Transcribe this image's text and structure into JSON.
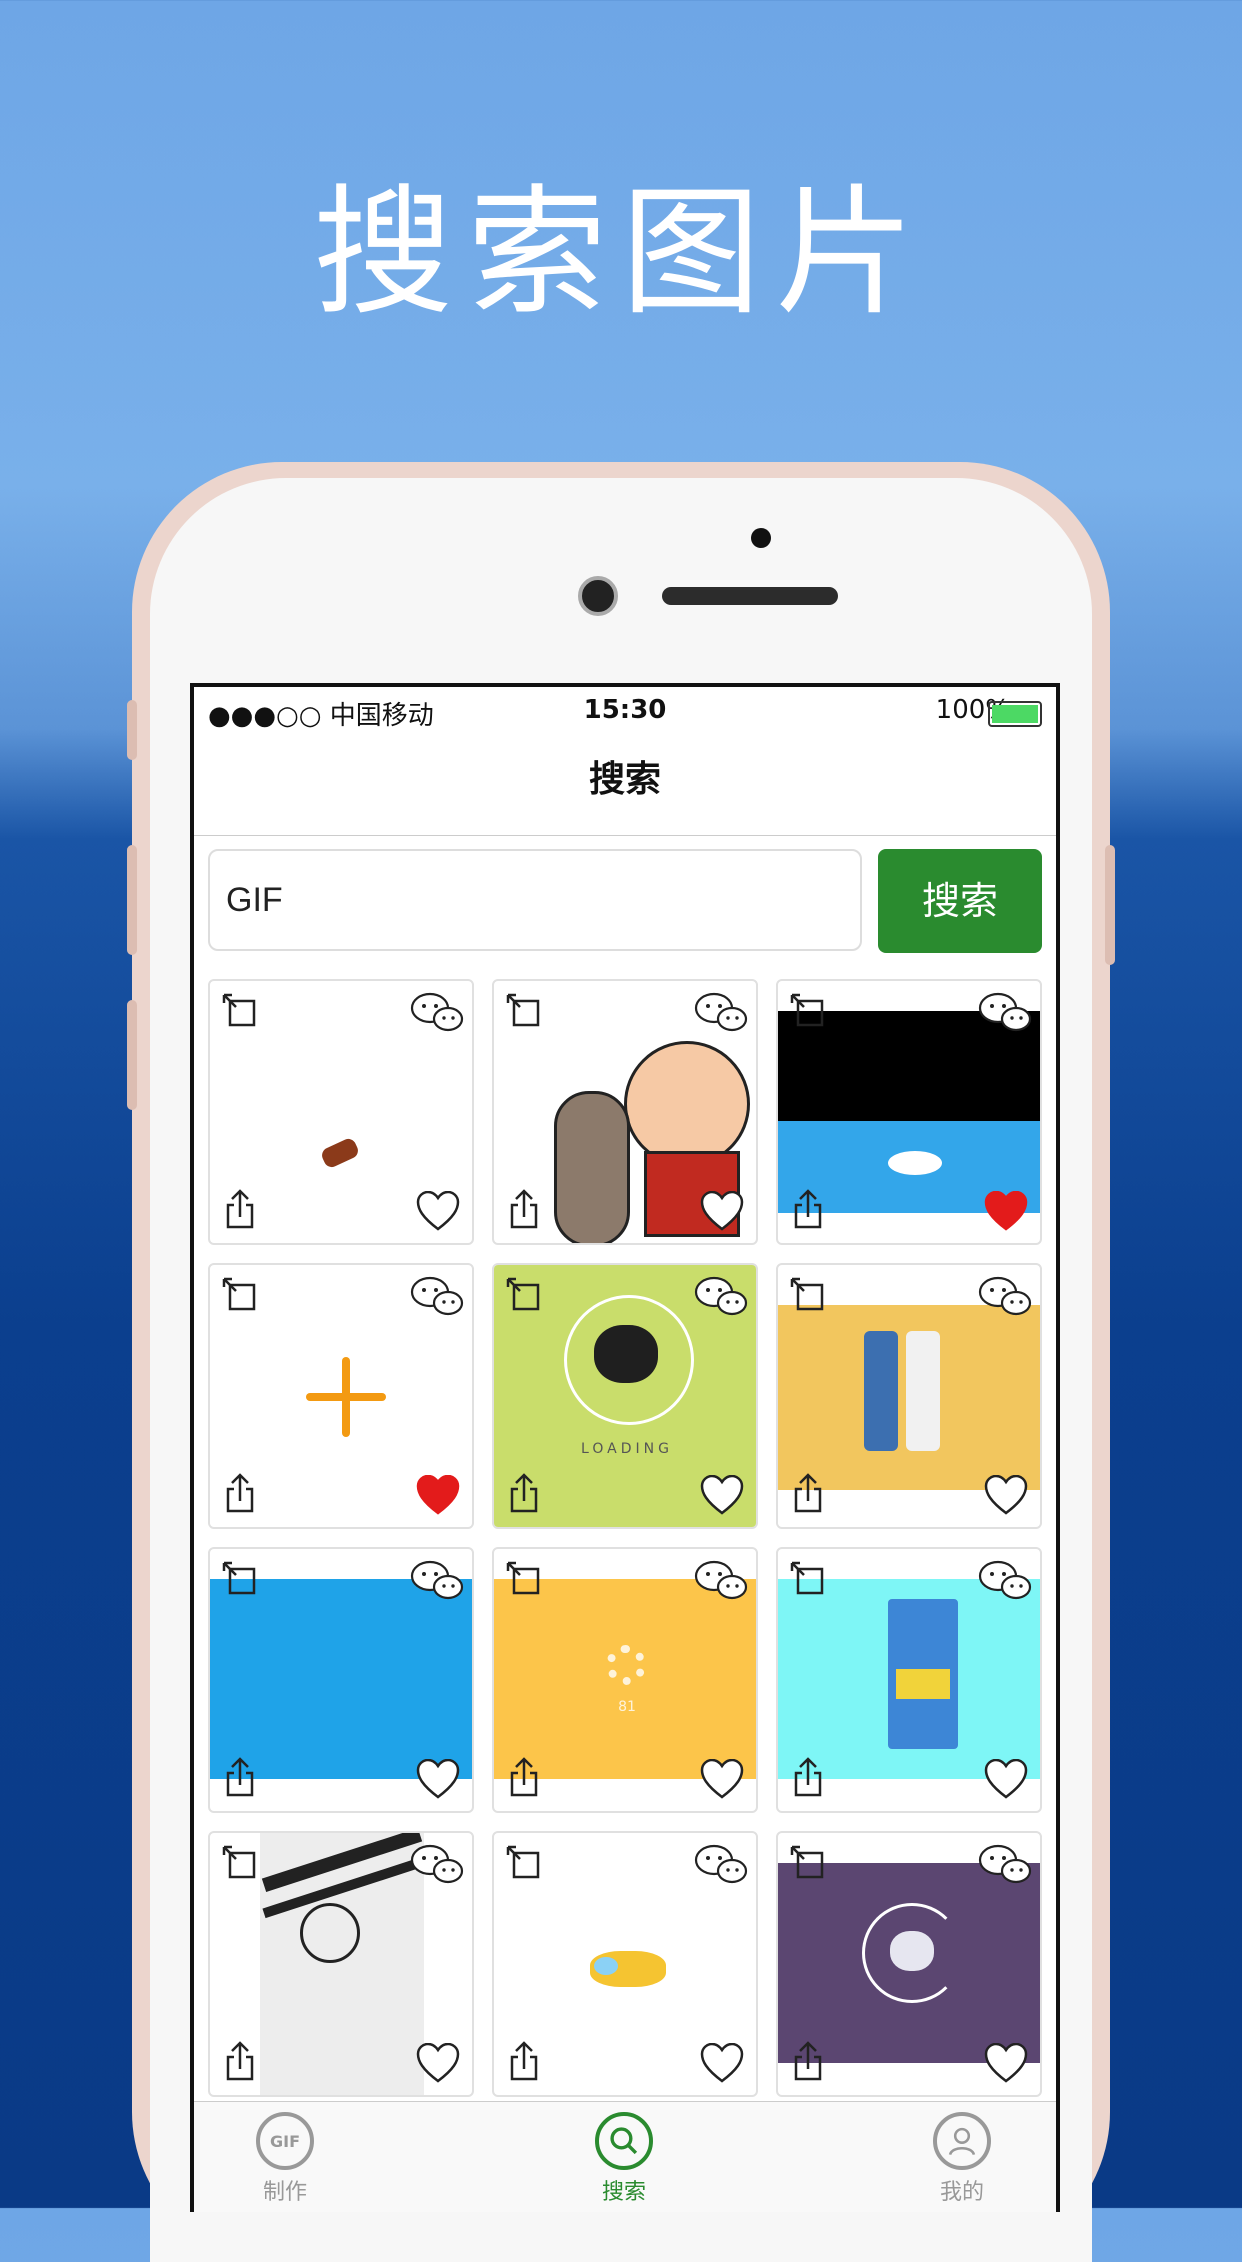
{
  "headline": "搜索图片",
  "status_bar": {
    "carrier": "●●●○○ 中国移动",
    "time": "15:30",
    "battery": "100%"
  },
  "nav": {
    "title": "搜索"
  },
  "search": {
    "value": "GIF",
    "button_label": "搜索"
  },
  "results": [
    {
      "label": "",
      "liked": false
    },
    {
      "label": "",
      "liked": false
    },
    {
      "label": "",
      "liked": true
    },
    {
      "label": "",
      "liked": true
    },
    {
      "label": "LOADING",
      "liked": false
    },
    {
      "label": "",
      "liked": false
    },
    {
      "label": "",
      "liked": false
    },
    {
      "label": "81",
      "liked": false
    },
    {
      "label": "",
      "liked": false
    },
    {
      "label": "",
      "liked": false
    },
    {
      "label": "",
      "liked": false
    },
    {
      "label": "",
      "liked": false
    }
  ],
  "tabs": [
    {
      "label": "制作",
      "icon_text": "GIF",
      "icon": "gif-icon",
      "active": false
    },
    {
      "label": "搜索",
      "icon_text": "",
      "icon": "search-icon",
      "active": true
    },
    {
      "label": "我的",
      "icon_text": "",
      "icon": "user-icon",
      "active": false
    }
  ],
  "colors": {
    "accent": "#2a8b2f",
    "liked": "#e31b1b"
  }
}
